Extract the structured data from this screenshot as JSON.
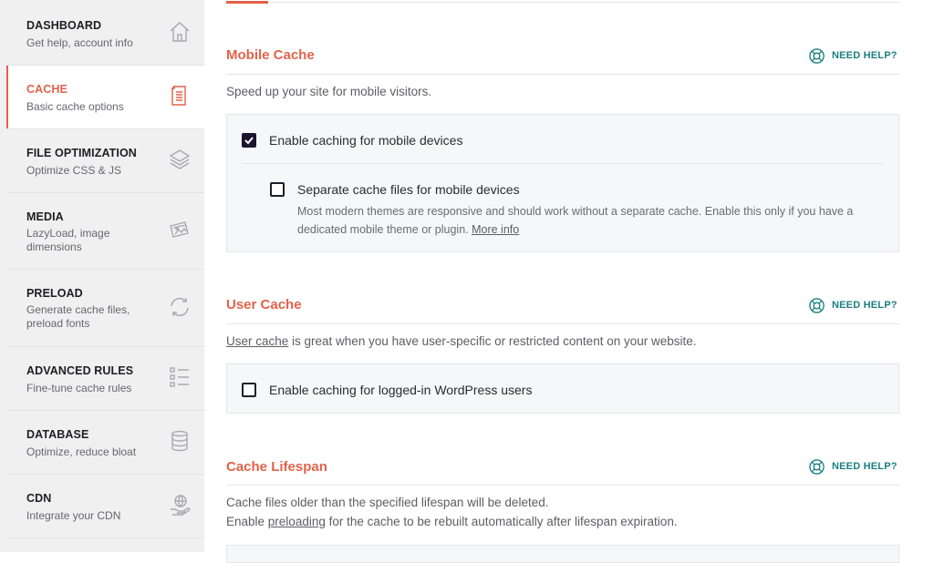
{
  "colors": {
    "accent": "#e2624a",
    "help": "#1c7f82",
    "sidebar_bg": "#f0f0f1",
    "checkbox_checked": "#1c1530"
  },
  "sidebar": {
    "items": [
      {
        "title": "DASHBOARD",
        "subtitle": "Get help, account info",
        "icon": "home-icon"
      },
      {
        "title": "CACHE",
        "subtitle": "Basic cache options",
        "icon": "document-icon",
        "active": true
      },
      {
        "title": "FILE OPTIMIZATION",
        "subtitle": "Optimize CSS & JS",
        "icon": "layers-icon"
      },
      {
        "title": "MEDIA",
        "subtitle": "LazyLoad, image dimensions",
        "icon": "images-icon"
      },
      {
        "title": "PRELOAD",
        "subtitle": "Generate cache files, preload fonts",
        "icon": "refresh-icon"
      },
      {
        "title": "ADVANCED RULES",
        "subtitle": "Fine-tune cache rules",
        "icon": "checklist-icon"
      },
      {
        "title": "DATABASE",
        "subtitle": "Optimize, reduce bloat",
        "icon": "database-icon"
      },
      {
        "title": "CDN",
        "subtitle": "Integrate your CDN",
        "icon": "globe-hand-icon"
      }
    ]
  },
  "help_label": "NEED HELP?",
  "mobile_cache": {
    "title": "Mobile Cache",
    "description": "Speed up your site for mobile visitors.",
    "enable_label": "Enable caching for mobile devices",
    "enable_checked": true,
    "separate_label": "Separate cache files for mobile devices",
    "separate_checked": false,
    "separate_desc": "Most modern themes are responsive and should work without a separate cache. Enable this only if you have a",
    "separate_desc2": "dedicated mobile theme or plugin.",
    "more_info": "More info"
  },
  "user_cache": {
    "title": "User Cache",
    "desc_link": "User cache",
    "desc_rest": " is great when you have user-specific or restricted content on your website.",
    "enable_label": "Enable caching for logged-in WordPress users",
    "enable_checked": false
  },
  "cache_lifespan": {
    "title": "Cache Lifespan",
    "desc1": "Cache files older than the specified lifespan will be deleted.",
    "desc2_pre": "Enable ",
    "desc2_link": "preloading",
    "desc2_post": " for the cache to be rebuilt automatically after lifespan expiration."
  }
}
